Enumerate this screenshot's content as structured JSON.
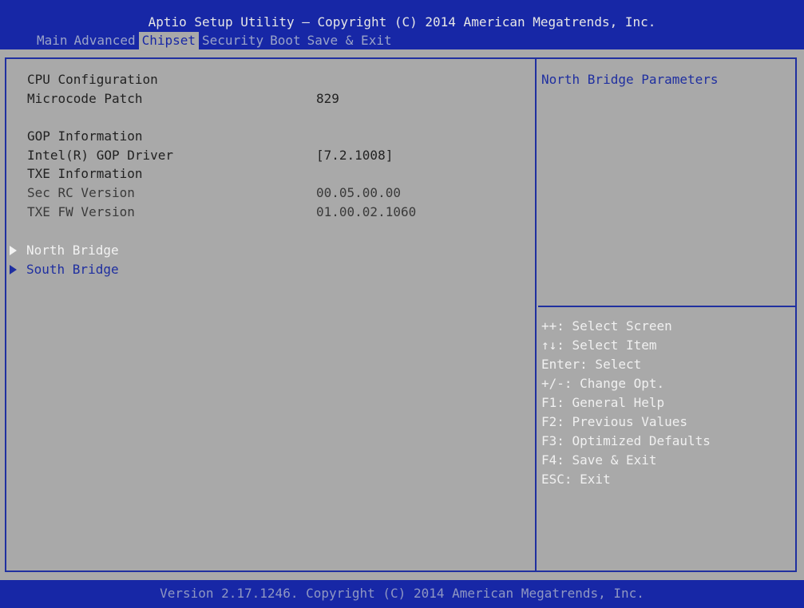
{
  "header": {
    "title": "Aptio Setup Utility – Copyright (C) 2014 American Megatrends, Inc.",
    "tabs": [
      {
        "label": "Main"
      },
      {
        "label": "Advanced"
      },
      {
        "label": "Chipset"
      },
      {
        "label": "Security"
      },
      {
        "label": "Boot"
      },
      {
        "label": "Save & Exit"
      }
    ],
    "active_tab": "Chipset"
  },
  "main": {
    "cpu_config_heading": "CPU Configuration",
    "microcode_label": "Microcode Patch",
    "microcode_value": "829",
    "gop_heading": "GOP Information",
    "gop_driver_label": "Intel(R) GOP Driver",
    "gop_driver_value": "[7.2.1008]",
    "txe_heading": "TXE Information",
    "sec_rc_label": "Sec RC Version",
    "sec_rc_value": "00.05.00.00",
    "txe_fw_label": "TXE FW Version",
    "txe_fw_value": "01.00.02.1060",
    "submenus": [
      {
        "label": "North Bridge",
        "selected": true
      },
      {
        "label": "South Bridge",
        "selected": false
      }
    ]
  },
  "help": {
    "description": "North Bridge Parameters",
    "keys": [
      "++: Select Screen",
      "↑↓: Select Item",
      "Enter: Select",
      "+/-: Change Opt.",
      "F1: General Help",
      "F2: Previous Values",
      "F3: Optimized Defaults",
      "F4: Save & Exit",
      "ESC: Exit"
    ]
  },
  "footer": {
    "version": "Version 2.17.1246. Copyright (C) 2014 American Megatrends, Inc."
  },
  "colors": {
    "header_bg": "#1727a6",
    "panel_bg": "#a9a9a9",
    "highlight_text": "#f2f2f2",
    "link_text": "#1f2fa0"
  }
}
